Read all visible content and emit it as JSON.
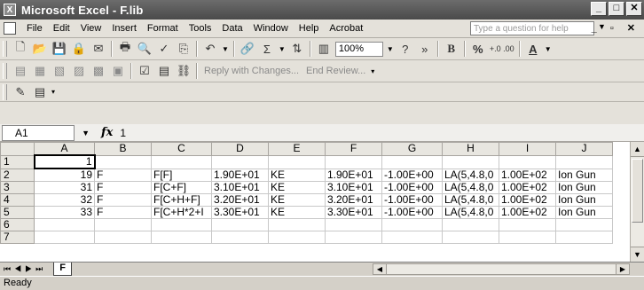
{
  "window": {
    "title": "Microsoft Excel - F.lib"
  },
  "menu": {
    "items": [
      "File",
      "Edit",
      "View",
      "Insert",
      "Format",
      "Tools",
      "Data",
      "Window",
      "Help",
      "Acrobat"
    ],
    "ask_placeholder": "Type a question for help"
  },
  "toolbar": {
    "zoom": "100%",
    "bold_label": "B",
    "percent_label": "%",
    "decimal_label": "+.0 .00",
    "font_color_label": "A"
  },
  "reviewing": {
    "reply_label": "Reply with Changes...",
    "end_review_label": "End Review..."
  },
  "formula_bar": {
    "name_box": "A1",
    "fx_label": "fx",
    "formula": "1"
  },
  "sheet": {
    "columns": [
      "A",
      "B",
      "C",
      "D",
      "E",
      "F",
      "G",
      "H",
      "I",
      "J"
    ],
    "rows": [
      {
        "n": "1",
        "cells": [
          "1",
          "",
          "",
          "",
          "",
          "",
          "",
          "",
          "",
          ""
        ]
      },
      {
        "n": "2",
        "cells": [
          "19",
          "F",
          "F[F]",
          "1.90E+01",
          "KE",
          "1.90E+01",
          "-1.00E+00",
          "LA(5,4.8,0",
          "1.00E+02",
          "Ion Gun"
        ]
      },
      {
        "n": "3",
        "cells": [
          "31",
          "F",
          "F[C+F]",
          "3.10E+01",
          "KE",
          "3.10E+01",
          "-1.00E+00",
          "LA(5,4.8,0",
          "1.00E+02",
          "Ion Gun"
        ]
      },
      {
        "n": "4",
        "cells": [
          "32",
          "F",
          "F[C+H+F]",
          "3.20E+01",
          "KE",
          "3.20E+01",
          "-1.00E+00",
          "LA(5,4.8,0",
          "1.00E+02",
          "Ion Gun"
        ]
      },
      {
        "n": "5",
        "cells": [
          "33",
          "F",
          "F[C+H*2+I",
          "3.30E+01",
          "KE",
          "3.30E+01",
          "-1.00E+00",
          "LA(5,4.8,0",
          "1.00E+02",
          "Ion Gun"
        ]
      },
      {
        "n": "6",
        "cells": [
          "",
          "",
          "",
          "",
          "",
          "",
          "",
          "",
          "",
          ""
        ]
      },
      {
        "n": "7",
        "cells": [
          "",
          "",
          "",
          "",
          "",
          "",
          "",
          "",
          "",
          ""
        ]
      }
    ]
  },
  "tabs": {
    "active": "F"
  },
  "status": {
    "text": "Ready"
  }
}
